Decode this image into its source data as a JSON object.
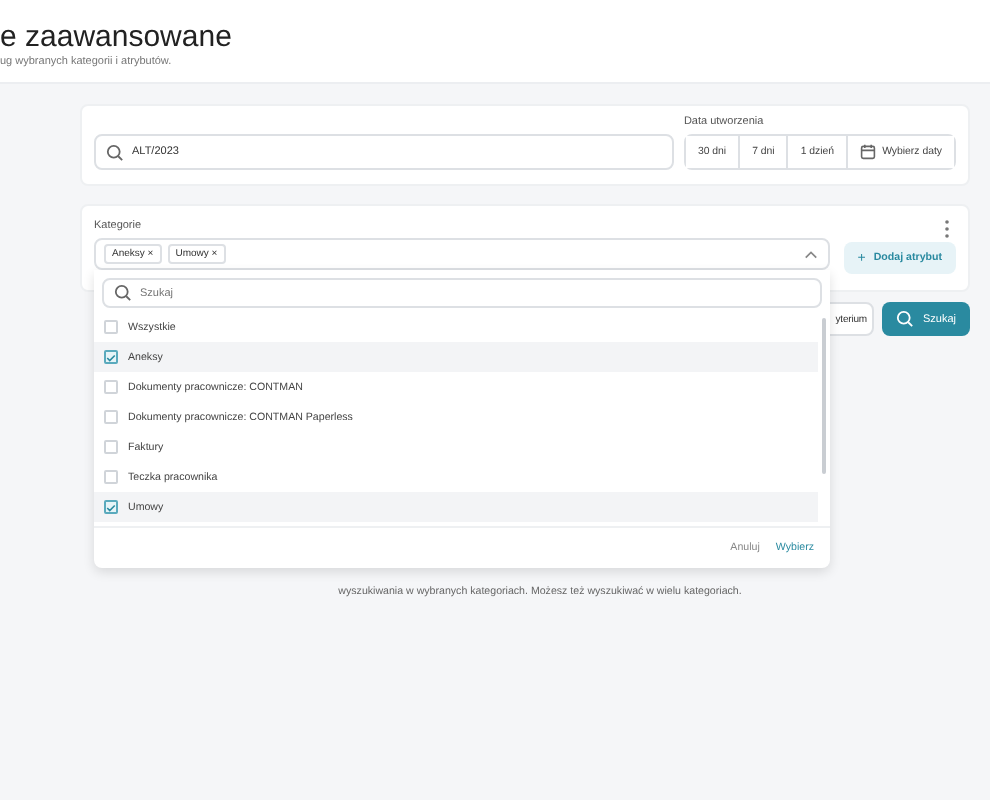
{
  "header": {
    "title": "e zaawansowane",
    "subtitle": "ug wybranych kategorii i atrybutów."
  },
  "search": {
    "value": "ALT/2023"
  },
  "date": {
    "label": "Data utworzenia",
    "options": [
      {
        "label": "30 dni"
      },
      {
        "label": "7 dni"
      },
      {
        "label": "1 dzień"
      }
    ],
    "pick_button": "Wybierz daty"
  },
  "categories": {
    "label": "Kategorie",
    "tags": [
      "Aneksy",
      "Umowy"
    ],
    "remove_mark": "×",
    "add_icon": "+",
    "add_button": "Dodaj atrybut",
    "dropdown": {
      "search_placeholder": "Szukaj",
      "items": [
        {
          "label": "Wszystkie",
          "checked": false
        },
        {
          "label": "Aneksy",
          "checked": true
        },
        {
          "label": "Dokumenty pracownicze: CONTMAN",
          "checked": false
        },
        {
          "label": "Dokumenty pracownicze: CONTMAN Paperless",
          "checked": false
        },
        {
          "label": "Faktury",
          "checked": false
        },
        {
          "label": "Teczka pracownika",
          "checked": false
        },
        {
          "label": "Umowy",
          "checked": true
        }
      ],
      "cancel": "Anuluj",
      "confirm": "Wybierz"
    }
  },
  "actions": {
    "criteria_button": "yterium",
    "search_button": "Szukaj"
  },
  "hint": "wyszukiwania w wybranych kategoriach. Możesz też wyszukiwać w wielu kategoriach."
}
